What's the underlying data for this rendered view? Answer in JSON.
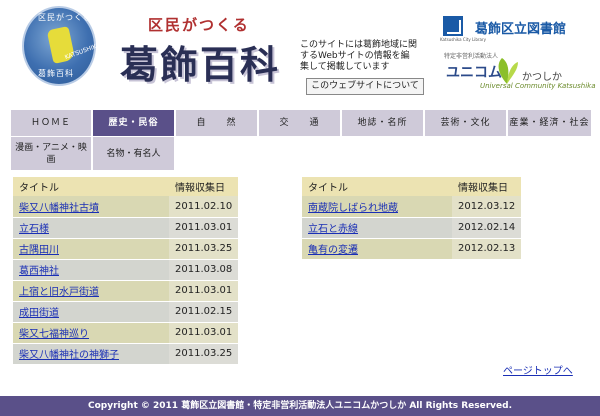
{
  "header": {
    "logo": {
      "ring_top": "区民がつくる",
      "ring_bottom": "葛飾百科",
      "inner": "KATSUSHIKA"
    },
    "title_small": "区民がつくる",
    "title_big": "葛飾百科",
    "intro": "このサイトには葛飾地域に関するWebサイトの情報を編集して掲載しています",
    "about_button": "このウェブサイトについて",
    "library": {
      "icon_sub": "Katsushika City Library",
      "name": "葛飾区立図書館"
    },
    "npo": {
      "sub": "特定非営利活動法人",
      "name": "ユニコム",
      "kana": "かつしか",
      "sub2": "Universal Community Katsushika"
    }
  },
  "nav": {
    "row1": [
      {
        "label": "ＨＯＭＥ",
        "active": false
      },
      {
        "label": "歴史・民俗",
        "active": true
      },
      {
        "label": "自　　然",
        "active": false
      },
      {
        "label": "交　　通",
        "active": false
      },
      {
        "label": "地誌・名所",
        "active": false
      },
      {
        "label": "芸術・文化",
        "active": false
      },
      {
        "label": "産業・経済・社会",
        "active": false
      }
    ],
    "row2": [
      {
        "label": "漫画・アニメ・映画"
      },
      {
        "label": "名物・有名人"
      }
    ]
  },
  "left_table": {
    "headers": [
      "タイトル",
      "情報収集日"
    ],
    "rows": [
      {
        "title": "柴又八幡神社古墳",
        "date": "2011.02.10"
      },
      {
        "title": "立石様",
        "date": "2011.03.01"
      },
      {
        "title": "古隅田川",
        "date": "2011.03.25"
      },
      {
        "title": "葛西神社",
        "date": "2011.03.08"
      },
      {
        "title": "上宿と旧水戸街道",
        "date": "2011.03.01"
      },
      {
        "title": "成田街道",
        "date": "2011.02.15"
      },
      {
        "title": "柴又七福神巡り",
        "date": "2011.03.01"
      },
      {
        "title": "柴又八幡神社の神獅子",
        "date": "2011.03.25"
      }
    ]
  },
  "right_table": {
    "headers": [
      "タイトル",
      "情報収集日"
    ],
    "rows": [
      {
        "title": "南蔵院しばられ地蔵",
        "date": "2012.03.12"
      },
      {
        "title": "立石と赤線",
        "date": "2012.02.14"
      },
      {
        "title": "亀有の変遷",
        "date": "2012.02.13"
      }
    ]
  },
  "page_top": "ページトップへ",
  "footer": "Copyright © 2011 葛飾区立図書館・特定非営利活動法人ユニコムかつしか All Rights Reserved.",
  "colors": {
    "nav_bg": "#cfcad9",
    "nav_active": "#5a5089",
    "footer_bg": "#5a5089",
    "link": "#1a2fb5"
  }
}
